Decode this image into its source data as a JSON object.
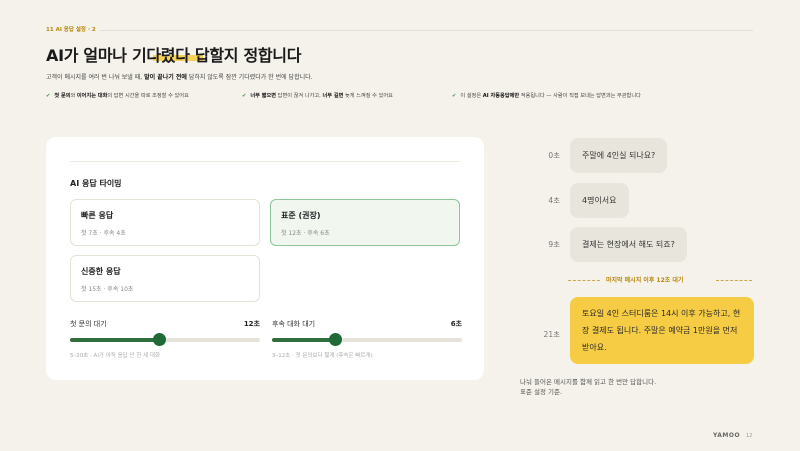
{
  "header": {
    "section_tag": "11  AI 응답 설정 · 2",
    "title_prefix": "AI가 얼마나 ",
    "title_highlight": "기다렸다",
    "title_suffix": " 답할지 정합니다",
    "desc_before": "고객이 메시지를 여러 번 나눠 보낼 때, ",
    "desc_bold": "말이 끝나기 전에",
    "desc_after": " 답하지 않도록 잠깐 기다렸다가 한 번에 답합니다."
  },
  "bullets": [
    {
      "b1": "첫 문의",
      "t1": "와 ",
      "b2": "이어지는 대화",
      "t2": "의 답변 시간을 따로 조정할 수 있어요"
    },
    {
      "b1": "너무 짧으면",
      "t1": " 답변이 끊겨 나가고, ",
      "b2": "너무 길면",
      "t2": " 늦게 느껴질 수 있어요"
    },
    {
      "b1": "",
      "t1": "이 설정은 ",
      "b2": "AI 자동응답에만",
      "t2": " 적용됩니다 — 사람이 직접 보내는 답변과는 무관합니다"
    }
  ],
  "panel": {
    "title": "AI 응답 타이밍",
    "options": [
      {
        "name": "빠른 응답",
        "sub": "첫 7초 · 후속 4초",
        "selected": false
      },
      {
        "name": "표준 (권장)",
        "sub": "첫 12초 · 후속 6초",
        "selected": true
      },
      {
        "name": "신중한 응답",
        "sub": "첫 15초 · 후속 10초",
        "selected": false
      }
    ],
    "sliders": [
      {
        "label": "첫 문의 대기",
        "value_text": "12초",
        "fraction": 0.47,
        "hint": "5–20초 · AI가 아직 응답 안 한 새 대화"
      },
      {
        "label": "후속 대화 대기",
        "value_text": "6초",
        "fraction": 0.33,
        "hint": "3–12초 · 첫 문의보다 짧게 (후속은 빠르게)"
      }
    ]
  },
  "chat": {
    "messages": [
      {
        "time": "0초",
        "text": "주말에 4인실 되나요?"
      },
      {
        "time": "4초",
        "text": "4명이서요"
      },
      {
        "time": "9초",
        "text": "결제는 현장에서 해도 되죠?"
      }
    ],
    "divider": "마지막 메시지 이후 12초 대기",
    "reply": {
      "time": "21초",
      "text": "토요일 4인 스터디룸은 14시 이후 가능하고, 현장 결제도 됩니다. 주말은 예약금 1만원을 먼저 받아요."
    },
    "note_line1": "나눠 들어온 메시지를 함께 읽고 한 번만 답합니다.",
    "note_line2": "표준 설정 기준."
  },
  "footer": {
    "brand": "YAMOO",
    "page": "12"
  },
  "colors": {
    "accent": "#f6cc45",
    "green": "#1f6a36",
    "bg": "#f4f2ea"
  }
}
